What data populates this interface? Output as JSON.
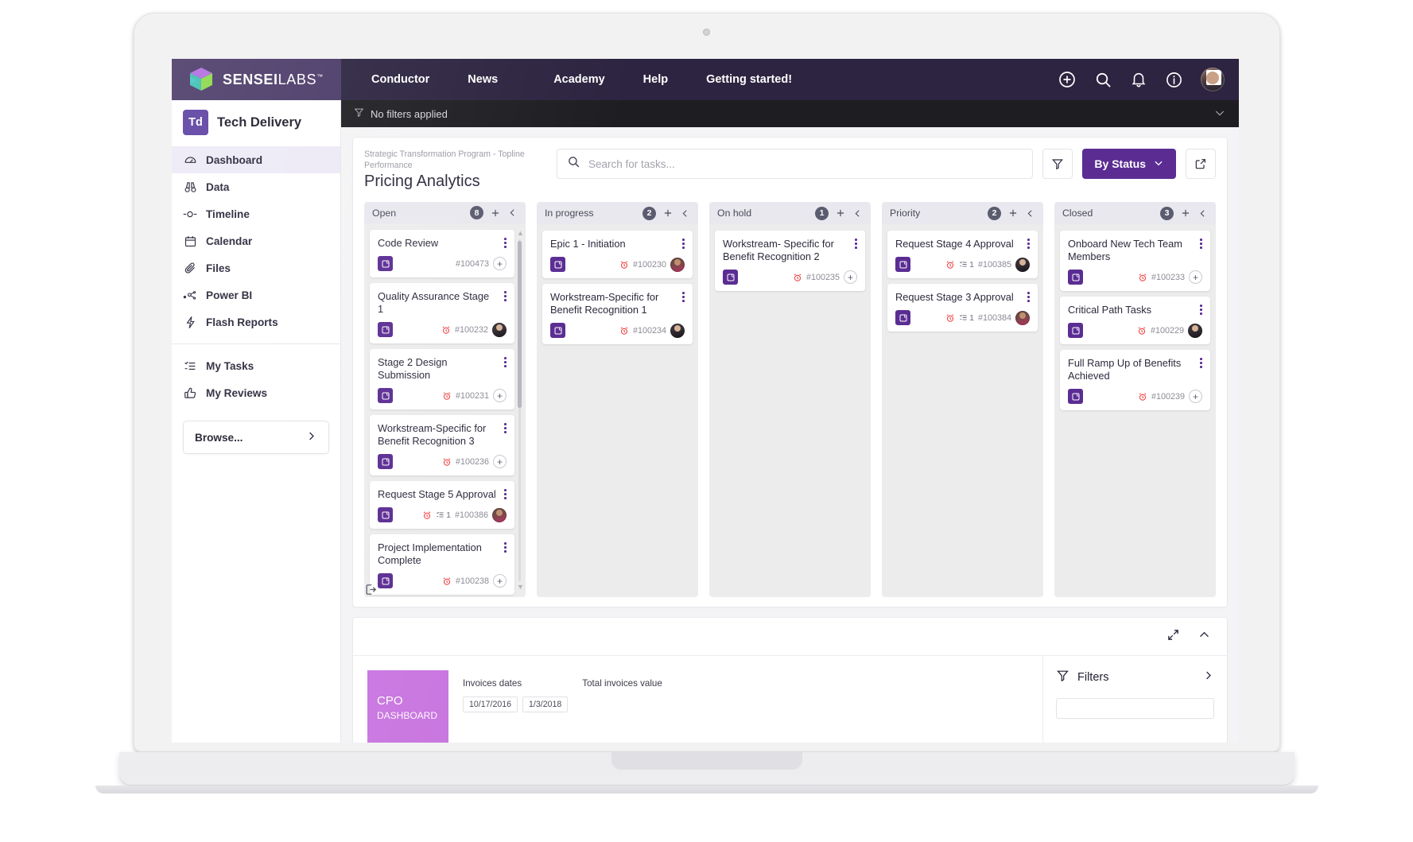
{
  "brand": {
    "name_bold": "SENSEI",
    "name_light": "LABS",
    "tm": "™",
    "logo_icon": "sensei-cube-logo"
  },
  "topnav": {
    "items": [
      {
        "label": "Conductor",
        "icon": "conductor-nav"
      },
      {
        "label": "News",
        "icon": "news-nav"
      },
      {
        "label": "Academy",
        "icon": "academy-nav"
      },
      {
        "label": "Help",
        "icon": "help-nav"
      },
      {
        "label": "Getting started!",
        "icon": "getting-started-nav"
      }
    ],
    "actions": [
      {
        "name": "add-icon",
        "glyph": "⊕"
      },
      {
        "name": "search-icon",
        "glyph": "⌕"
      },
      {
        "name": "bell-icon",
        "glyph": "␇"
      },
      {
        "name": "info-icon",
        "glyph": "ⓘ"
      }
    ],
    "avatar_badge": "⚙"
  },
  "filterbar": {
    "icon": "filter-icon",
    "label": "No filters applied",
    "expand_icon": "chevron-down-icon"
  },
  "sidebar": {
    "workspace": {
      "initials": "Td",
      "name": "Tech Delivery"
    },
    "items": [
      {
        "label": "Dashboard",
        "icon": "gauge-icon",
        "active": true
      },
      {
        "label": "Data",
        "icon": "binoculars-icon",
        "active": false
      },
      {
        "label": "Timeline",
        "icon": "timeline-icon",
        "active": false
      },
      {
        "label": "Calendar",
        "icon": "calendar-icon",
        "active": false
      },
      {
        "label": "Files",
        "icon": "paperclip-icon",
        "active": false
      },
      {
        "label": "Power BI",
        "icon": "power-bi-icon",
        "active": false
      },
      {
        "label": "Flash Reports",
        "icon": "lightning-icon",
        "active": false
      }
    ],
    "items2": [
      {
        "label": "My Tasks",
        "icon": "task-list-icon"
      },
      {
        "label": "My Reviews",
        "icon": "thumbs-up-icon"
      }
    ],
    "browse": {
      "label": "Browse...",
      "icon": "chevron-right-icon"
    }
  },
  "board": {
    "breadcrumb": "Strategic Transformation Program - Topline Performance",
    "title": "Pricing Analytics",
    "search_placeholder": "Search for tasks...",
    "search_value": "",
    "search_icon": "search-icon",
    "filter_icon": "filter-icon",
    "group_button": {
      "label": "By Status",
      "icon": "chevron-down-icon"
    },
    "open_external_icon": "open-external-icon",
    "footer_icon": "export-icon",
    "columns": [
      {
        "name": "Open",
        "count": "8",
        "add_icon": "plus-icon",
        "collapse_icon": "chevron-left-icon",
        "has_scrollbar": true,
        "tasks": [
          {
            "title": "Code Review",
            "id": "#100473",
            "type_icon": "task-type-icon",
            "alarm": false,
            "subtasks": null,
            "assignee": null,
            "add": true
          },
          {
            "title": "Quality Assurance Stage 1",
            "id": "#100232",
            "type_icon": "task-type-icon",
            "alarm": true,
            "subtasks": null,
            "assignee": "a1",
            "add": false
          },
          {
            "title": "Stage 2 Design Submission",
            "id": "#100231",
            "type_icon": "task-type-icon",
            "alarm": true,
            "subtasks": null,
            "assignee": null,
            "add": true
          },
          {
            "title": "Workstream-Specific for Benefit Recognition 3",
            "id": "#100236",
            "type_icon": "task-type-icon",
            "alarm": true,
            "subtasks": null,
            "assignee": null,
            "add": true
          },
          {
            "title": "Request Stage 5 Approval",
            "id": "#100386",
            "type_icon": "task-type-icon",
            "alarm": true,
            "subtasks": "1",
            "assignee": "a2",
            "add": false
          },
          {
            "title": "Project Implementation Complete",
            "id": "#100238",
            "type_icon": "task-type-icon",
            "alarm": true,
            "subtasks": null,
            "assignee": null,
            "add": true
          }
        ]
      },
      {
        "name": "In progress",
        "count": "2",
        "add_icon": "plus-icon",
        "collapse_icon": "chevron-left-icon",
        "has_scrollbar": false,
        "tasks": [
          {
            "title": "Epic 1 - Initiation",
            "id": "#100230",
            "type_icon": "task-type-icon",
            "alarm": true,
            "subtasks": null,
            "assignee": "a2",
            "add": false
          },
          {
            "title": "Workstream-Specific for Benefit Recognition 1",
            "id": "#100234",
            "type_icon": "task-type-icon",
            "alarm": true,
            "subtasks": null,
            "assignee": "a1",
            "add": false
          }
        ]
      },
      {
        "name": "On hold",
        "count": "1",
        "add_icon": "plus-icon",
        "collapse_icon": "chevron-left-icon",
        "has_scrollbar": false,
        "tasks": [
          {
            "title": "Workstream- Specific for Benefit Recognition 2",
            "id": "#100235",
            "type_icon": "task-type-icon",
            "alarm": true,
            "subtasks": null,
            "assignee": null,
            "add": true
          }
        ]
      },
      {
        "name": "Priority",
        "count": "2",
        "add_icon": "plus-icon",
        "collapse_icon": "chevron-left-icon",
        "has_scrollbar": false,
        "tasks": [
          {
            "title": "Request Stage 4 Approval",
            "id": "#100385",
            "type_icon": "task-type-icon",
            "alarm": true,
            "subtasks": "1",
            "assignee": "a1",
            "add": false
          },
          {
            "title": "Request Stage 3 Approval",
            "id": "#100384",
            "type_icon": "task-type-icon",
            "alarm": true,
            "subtasks": "1",
            "assignee": "a2",
            "add": false
          }
        ]
      },
      {
        "name": "Closed",
        "count": "3",
        "add_icon": "plus-icon",
        "collapse_icon": "chevron-left-icon",
        "has_scrollbar": false,
        "tasks": [
          {
            "title": "Onboard New Tech Team Members",
            "id": "#100233",
            "type_icon": "task-type-icon",
            "alarm": true,
            "subtasks": null,
            "assignee": null,
            "add": true
          },
          {
            "title": "Critical Path Tasks",
            "id": "#100229",
            "type_icon": "task-type-icon",
            "alarm": true,
            "subtasks": null,
            "assignee": "a1",
            "add": false
          },
          {
            "title": "Full Ramp Up of Benefits Achieved",
            "id": "#100239",
            "type_icon": "task-type-icon",
            "alarm": true,
            "subtasks": null,
            "assignee": null,
            "add": true
          }
        ]
      }
    ]
  },
  "bottom_panel": {
    "expand_icon": "expand-diagonal-icon",
    "collapse_icon": "chevron-up-icon",
    "tile": {
      "line1": "CPO",
      "line2": "DASHBOARD"
    },
    "kpis": [
      {
        "label": "Invoices dates",
        "dates": [
          "10/17/2016",
          "1/3/2018"
        ],
        "value": ""
      },
      {
        "label": "Total invoices value",
        "dates": [],
        "value": ""
      }
    ],
    "filters": {
      "label": "Filters",
      "icon": "filter-icon",
      "chevron": "chevron-right-icon"
    }
  },
  "colors": {
    "brand_purple": "#5b2d93",
    "topbar": "#2c2440",
    "brand_panel": "#4a3a68",
    "accent_magenta": "#c977e0",
    "alarm_red": "#ef2d2d"
  }
}
